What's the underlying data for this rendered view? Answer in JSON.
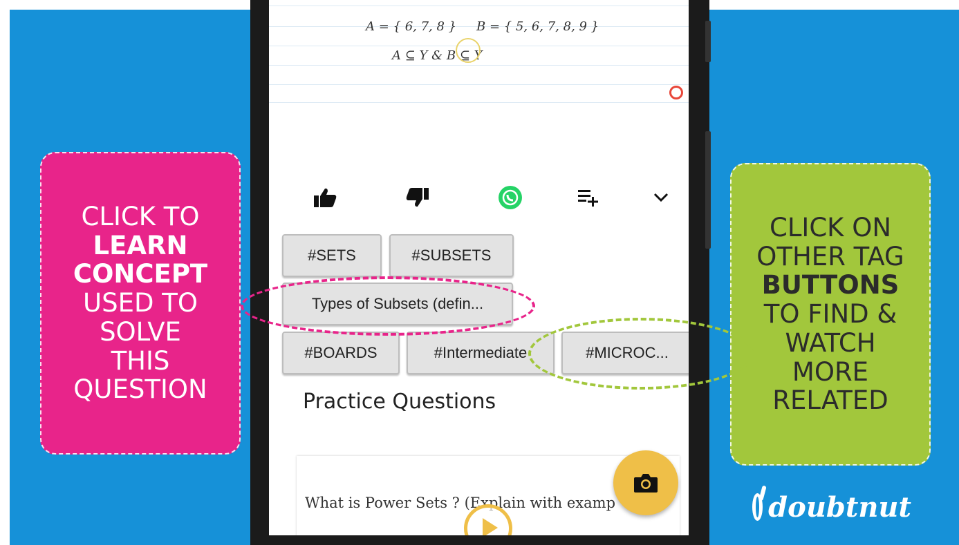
{
  "left_callout": {
    "line1": "CLICK TO",
    "line2": "LEARN",
    "line3": "CONCEPT",
    "line4": "USED TO",
    "line5": "SOLVE",
    "line6": "THIS",
    "line7": "QUESTION"
  },
  "right_callout": {
    "line1": "CLICK ON",
    "line2": "OTHER TAG",
    "line3": "BUTTONS",
    "line4": "TO FIND &",
    "line5": "WATCH",
    "line6": "MORE",
    "line7": "RELATED"
  },
  "brand": {
    "name": "doubtnut"
  },
  "notebook": {
    "line_a": "A = { 6, 7, 8 }",
    "line_b": "B = { 5, 6, 7, 8, 9 }",
    "line_c": "A ⊆ Y & B ⊆ Y"
  },
  "actions": [
    {
      "icon": "thumbs-up-icon"
    },
    {
      "icon": "thumbs-down-icon"
    },
    {
      "icon": "whatsapp-icon"
    },
    {
      "icon": "add-to-playlist-icon"
    },
    {
      "icon": "chevron-down-icon"
    }
  ],
  "tags": {
    "sets": "#SETS",
    "subsets": "#SUBSETS",
    "types": "Types of Subsets (defin...",
    "boards": "#BOARDS",
    "intermediate": "#Intermediate",
    "microc": "#MICROC..."
  },
  "practice": {
    "title": "Practice Questions",
    "question": "What is Power Sets ? (Explain with examp"
  },
  "colors": {
    "background": "#1691d8",
    "left_callout": "#e8248a",
    "right_callout": "#a2c73c",
    "accent": "#efbf48",
    "whatsapp": "#25d366"
  }
}
